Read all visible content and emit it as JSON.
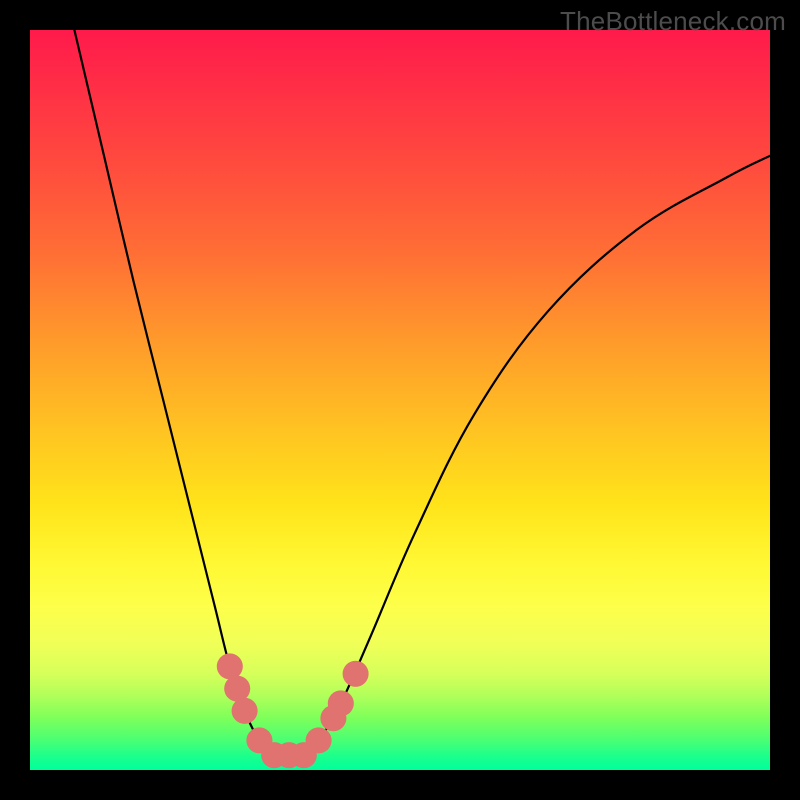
{
  "watermark": "TheBottleneck.com",
  "chart_data": {
    "type": "line",
    "title": "",
    "xlabel": "",
    "ylabel": "",
    "xlim": [
      0,
      100
    ],
    "ylim": [
      0,
      100
    ],
    "grid": false,
    "legend": false,
    "background_gradient": {
      "top": "#ff1a4b",
      "mid": "#ffe31a",
      "bottom": "#00ff9c"
    },
    "series": [
      {
        "name": "bottleneck-curve",
        "color": "#000000",
        "x": [
          6,
          10,
          14,
          18,
          22,
          25,
          27,
          29,
          31,
          33,
          35,
          37,
          39,
          42,
          46,
          52,
          60,
          70,
          82,
          94,
          100
        ],
        "y": [
          100,
          83,
          66,
          50,
          34,
          22,
          14,
          8,
          4,
          2,
          2,
          2,
          4,
          9,
          18,
          32,
          48,
          62,
          73,
          80,
          83
        ]
      }
    ],
    "markers": {
      "name": "highlight-points",
      "color": "#e0726f",
      "radius": 1.6,
      "points": [
        {
          "x": 27,
          "y": 14
        },
        {
          "x": 28,
          "y": 11
        },
        {
          "x": 29,
          "y": 8
        },
        {
          "x": 31,
          "y": 4
        },
        {
          "x": 33,
          "y": 2
        },
        {
          "x": 35,
          "y": 2
        },
        {
          "x": 37,
          "y": 2
        },
        {
          "x": 39,
          "y": 4
        },
        {
          "x": 41,
          "y": 7
        },
        {
          "x": 42,
          "y": 9
        },
        {
          "x": 44,
          "y": 13
        }
      ]
    }
  }
}
